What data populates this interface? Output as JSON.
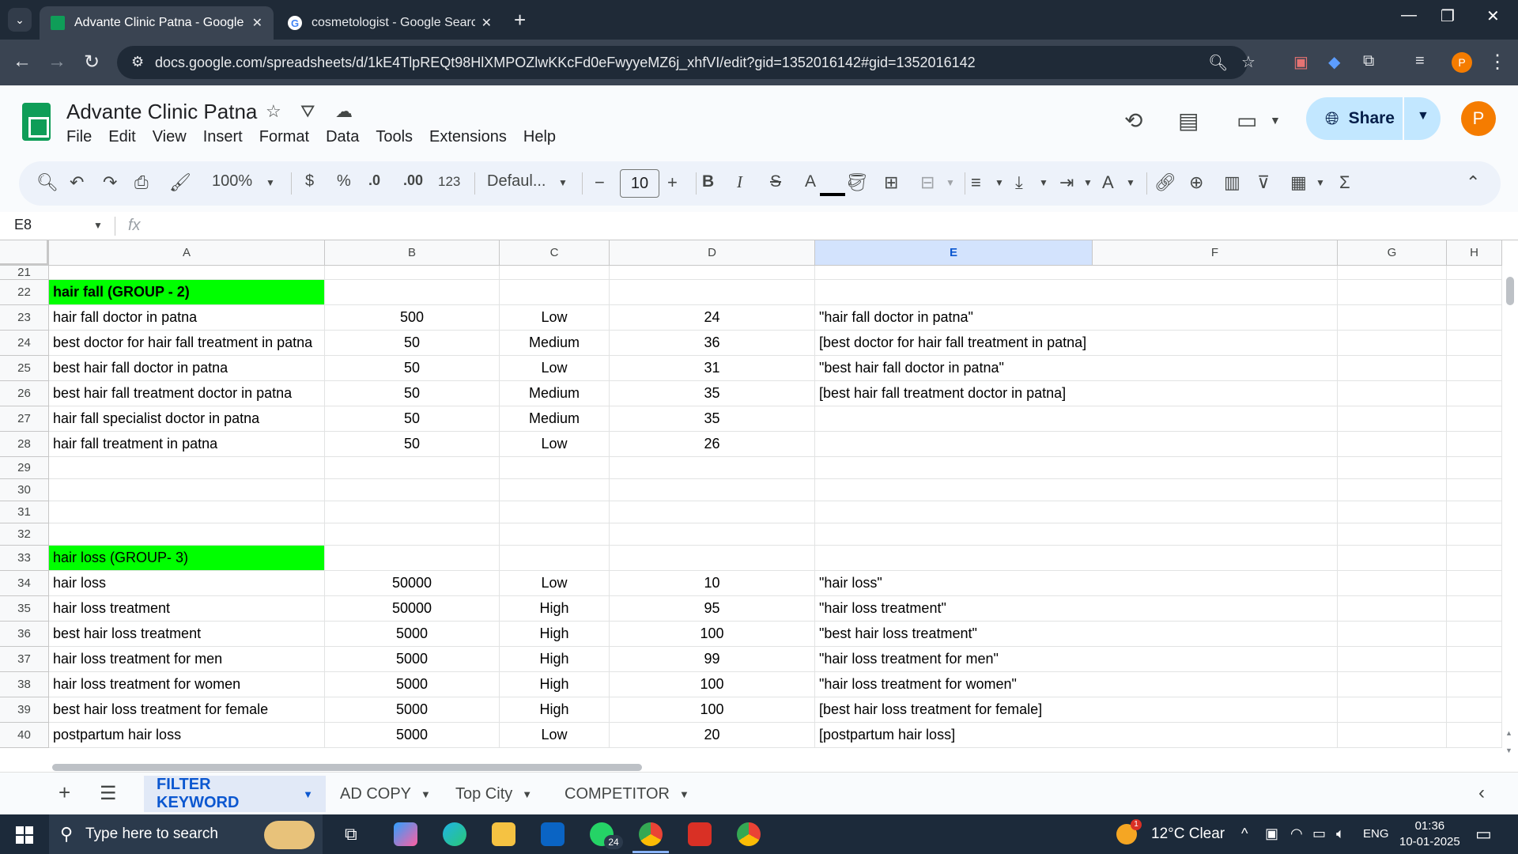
{
  "browser": {
    "tabs": [
      {
        "title": "Advante Clinic Patna - Google S",
        "active": true
      },
      {
        "title": "cosmetologist - Google Search",
        "active": false
      }
    ],
    "url": "docs.google.com/spreadsheets/d/1kE4TlpREQt98HlXMPOZlwKKcFd0eFwyyeMZ6j_xhfVI/edit?gid=1352016142#gid=1352016142"
  },
  "app": {
    "title": "Advante Clinic Patna",
    "menu": [
      "File",
      "Edit",
      "View",
      "Insert",
      "Format",
      "Data",
      "Tools",
      "Extensions",
      "Help"
    ],
    "share_label": "Share",
    "avatar_letter": "P"
  },
  "toolbar": {
    "zoom": "100%",
    "currency": "$",
    "percent": "%",
    "dec_decrease": ".0",
    "dec_increase": ".00",
    "number_format": "123",
    "font": "Defaul...",
    "font_size": "10",
    "bold": "B",
    "italic": "I",
    "strike": "S",
    "text_color": "A"
  },
  "formula_bar": {
    "name_box": "E8",
    "fx": "fx"
  },
  "grid": {
    "columns": [
      "A",
      "B",
      "C",
      "D",
      "E",
      "F",
      "G",
      "H"
    ],
    "selected_column": "E",
    "rows": [
      {
        "n": "21",
        "a": "",
        "b": "",
        "c": "",
        "d": "",
        "e": ""
      },
      {
        "n": "22",
        "a": "hair fall (GROUP - 2)",
        "b": "",
        "c": "",
        "d": "",
        "e": "",
        "a_style": "green-bold"
      },
      {
        "n": "23",
        "a": "hair fall doctor in patna",
        "b": "500",
        "c": "Low",
        "d": "24",
        "e": "\"hair fall doctor in patna\""
      },
      {
        "n": "24",
        "a": "best doctor for hair fall treatment in patna",
        "b": "50",
        "c": "Medium",
        "d": "36",
        "e": "[best doctor for hair fall treatment in patna]"
      },
      {
        "n": "25",
        "a": "best hair fall doctor in patna",
        "b": "50",
        "c": "Low",
        "d": "31",
        "e": "\"best hair fall doctor in patna\""
      },
      {
        "n": "26",
        "a": "best hair fall treatment doctor in patna",
        "b": "50",
        "c": "Medium",
        "d": "35",
        "e": "[best hair fall treatment doctor in patna]"
      },
      {
        "n": "27",
        "a": "hair fall specialist doctor in patna",
        "b": "50",
        "c": "Medium",
        "d": "35",
        "e": ""
      },
      {
        "n": "28",
        "a": "hair fall treatment in patna",
        "b": "50",
        "c": "Low",
        "d": "26",
        "e": ""
      },
      {
        "n": "29",
        "a": "",
        "b": "",
        "c": "",
        "d": "",
        "e": ""
      },
      {
        "n": "30",
        "a": "",
        "b": "",
        "c": "",
        "d": "",
        "e": ""
      },
      {
        "n": "31",
        "a": "",
        "b": "",
        "c": "",
        "d": "",
        "e": ""
      },
      {
        "n": "32",
        "a": "",
        "b": "",
        "c": "",
        "d": "",
        "e": ""
      },
      {
        "n": "33",
        "a": "hair loss (GROUP- 3)",
        "b": "",
        "c": "",
        "d": "",
        "e": "",
        "a_style": "green"
      },
      {
        "n": "34",
        "a": "hair loss",
        "b": "50000",
        "c": "Low",
        "d": "10",
        "e": "\"hair loss\""
      },
      {
        "n": "35",
        "a": "hair loss treatment",
        "b": "50000",
        "c": "High",
        "d": "95",
        "e": "\"hair loss treatment\""
      },
      {
        "n": "36",
        "a": "best hair loss treatment",
        "b": "5000",
        "c": "High",
        "d": "100",
        "e": "\"best hair loss treatment\""
      },
      {
        "n": "37",
        "a": "hair loss treatment for men",
        "b": "5000",
        "c": "High",
        "d": "99",
        "e": "\"hair loss treatment for men\""
      },
      {
        "n": "38",
        "a": "hair loss treatment for women",
        "b": "5000",
        "c": "High",
        "d": "100",
        "e": "\"hair loss treatment for women\""
      },
      {
        "n": "39",
        "a": "best hair loss treatment for female",
        "b": "5000",
        "c": "High",
        "d": "100",
        "e": "[best hair loss treatment for female]"
      },
      {
        "n": "40",
        "a": "postpartum hair loss",
        "b": "5000",
        "c": "Low",
        "d": "20",
        "e": "[postpartum hair loss]"
      }
    ]
  },
  "sheets": {
    "tabs": [
      "FILTER KEYWORD",
      "AD COPY",
      "Top City",
      "COMPETITOR"
    ],
    "active": "FILTER KEYWORD"
  },
  "taskbar": {
    "search_placeholder": "Type here to search",
    "whatsapp_badge": "24",
    "weather": "12°C  Clear",
    "weather_badge": "1",
    "lang": "ENG",
    "time": "01:36",
    "date": "10-01-2025"
  },
  "colors": {
    "group_highlight": "#00ff00",
    "selected_header": "#d3e3fd",
    "share_button": "#c2e7ff",
    "avatar": "#f57c00"
  }
}
